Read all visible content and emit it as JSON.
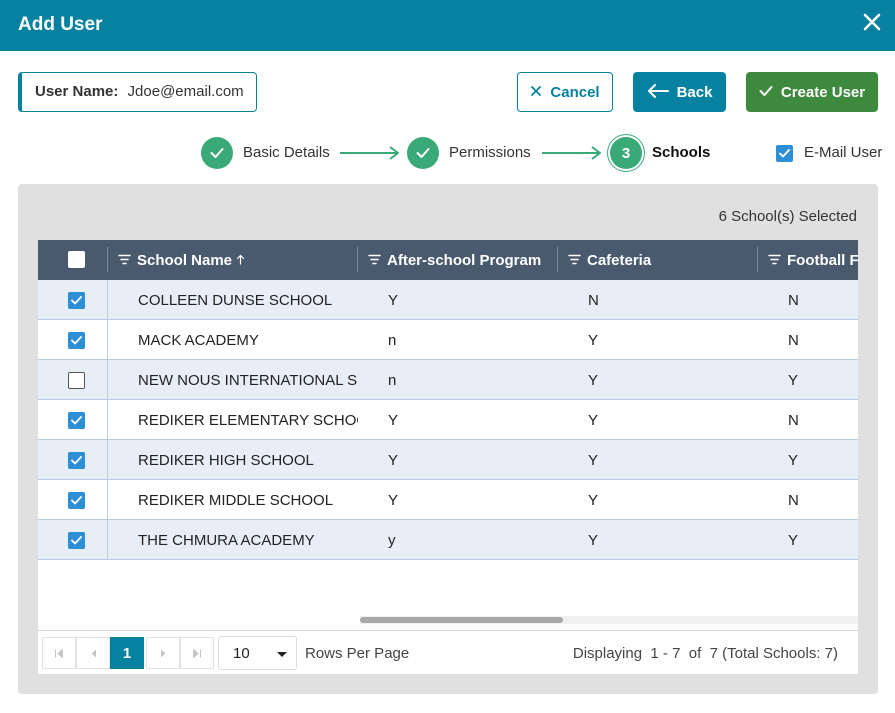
{
  "dialog": {
    "title": "Add User"
  },
  "user": {
    "label": "User Name:",
    "value": "Jdoe@email.com"
  },
  "buttons": {
    "cancel": "Cancel",
    "back": "Back",
    "create": "Create User"
  },
  "steps": [
    {
      "label": "Basic Details",
      "state": "done"
    },
    {
      "label": "Permissions",
      "state": "done"
    },
    {
      "label": "Schools",
      "state": "current",
      "number": "3"
    }
  ],
  "email_user": {
    "label": "E-Mail User",
    "checked": true
  },
  "selected_count": "6 School(s) Selected",
  "columns": [
    "School Name",
    "After-school Program",
    "Cafeteria",
    "Football F"
  ],
  "rows": [
    {
      "checked": true,
      "cells": [
        "COLLEEN DUNSE SCHOOL",
        "Y",
        "N",
        "N"
      ]
    },
    {
      "checked": true,
      "cells": [
        "MACK ACADEMY",
        "n",
        "Y",
        "N"
      ]
    },
    {
      "checked": false,
      "cells": [
        "NEW NOUS INTERNATIONAL S...",
        "n",
        "Y",
        "Y"
      ]
    },
    {
      "checked": true,
      "cells": [
        "REDIKER ELEMENTARY SCHOOL",
        "Y",
        "Y",
        "N"
      ]
    },
    {
      "checked": true,
      "cells": [
        "REDIKER HIGH SCHOOL",
        "Y",
        "Y",
        "Y"
      ]
    },
    {
      "checked": true,
      "cells": [
        "REDIKER MIDDLE SCHOOL",
        "Y",
        "Y",
        "N"
      ]
    },
    {
      "checked": true,
      "cells": [
        "THE CHMURA ACADEMY",
        "y",
        "Y",
        "Y"
      ]
    }
  ],
  "pager": {
    "current_page": "1",
    "rows_per_page": "10",
    "rows_per_page_label": "Rows Per Page",
    "display_text": "Displaying  1 - 7  of  7 (Total Schools: 7)"
  },
  "colors": {
    "header": "#06819f",
    "create": "#3d8a3f",
    "step_done": "#3aa978",
    "grid_header": "#4a5a6e",
    "checkbox": "#2d8fd5"
  }
}
